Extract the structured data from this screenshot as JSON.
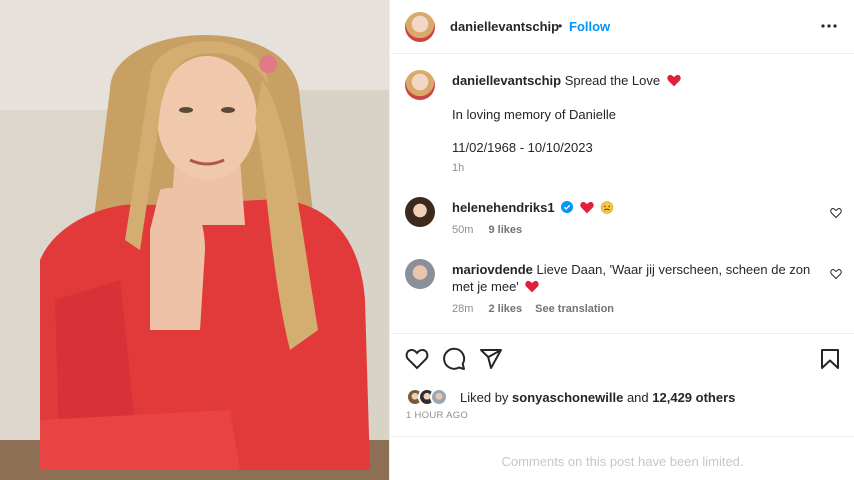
{
  "header": {
    "username": "daniellevantschip",
    "separator": "•",
    "follow_label": "Follow"
  },
  "caption": {
    "username": "daniellevantschip",
    "line1": "Spread the Love",
    "line2": "In loving memory of Danielle",
    "line3": "11/02/1968 - 10/10/2023",
    "time": "1h"
  },
  "comments": [
    {
      "username": "helenehendriks1",
      "text": "",
      "time": "50m",
      "likes": "9 likes"
    },
    {
      "username": "mariovdende",
      "text": "Lieve Daan, 'Waar jij verscheen, scheen de zon",
      "text2": "met je mee'",
      "time": "28m",
      "likes": "2 likes",
      "translate": "See translation"
    }
  ],
  "likes": {
    "prefix": "Liked by",
    "user": "sonyaschonewille",
    "and": "and",
    "others": "12,429 others"
  },
  "timestamp": "1 HOUR AGO",
  "limited_text": "Comments on this post have been limited.",
  "colors": {
    "accent": "#0095f6",
    "heart": "#ed4956",
    "verified": "#0095f6"
  },
  "icons": [
    "more-icon",
    "heart-icon",
    "comment-icon",
    "share-icon",
    "bookmark-icon",
    "verified-icon",
    "sad-emoji-icon"
  ]
}
